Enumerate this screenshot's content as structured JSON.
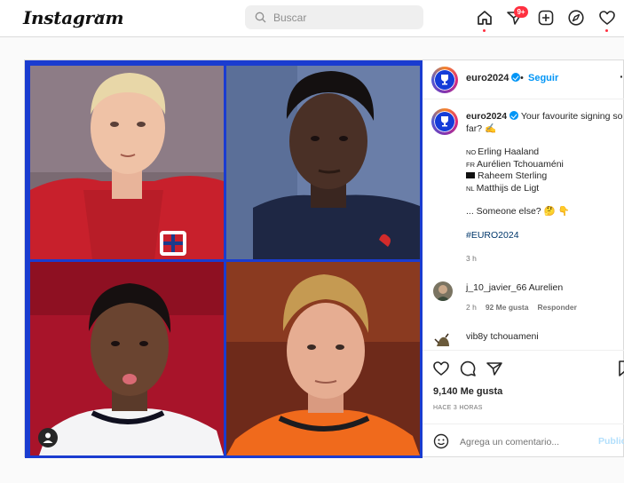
{
  "topbar": {
    "logo": "Instagram",
    "search_placeholder": "Buscar",
    "notification_badge": "9+",
    "icons": [
      "home-icon",
      "direct-icon",
      "new-post-icon",
      "explore-icon",
      "heart-icon"
    ]
  },
  "post": {
    "author": "euro2024",
    "follow_label": "Seguir",
    "separator": "•",
    "more_label": "···",
    "caption": {
      "username": "euro2024",
      "text": "Your favourite signing so far? ✍️",
      "players": [
        {
          "code": "NO",
          "name": "Erling Haaland"
        },
        {
          "code": "FR",
          "name": "Aurélien Tchouaméni"
        },
        {
          "code": "",
          "name": "Raheem Sterling"
        },
        {
          "code": "NL",
          "name": "Matthijs de Ligt"
        }
      ],
      "follow_up": "... Someone else? 🤔 👇",
      "hashtag": "#EURO2024",
      "time": "3 h"
    },
    "comments": [
      {
        "user": "j_10_javier_66",
        "text": "Aurelien",
        "time": "2 h",
        "likes": "92 Me gusta",
        "reply": "Responder"
      },
      {
        "user": "vib8y",
        "text": "tchouameni"
      }
    ],
    "likes": "9,140 Me gusta",
    "posted": "HACE 3 HORAS",
    "comment_placeholder": "Agrega un comentario...",
    "publish_label": "Publicar"
  },
  "colors": {
    "accent": "#0095f6",
    "euro_blue": "#1a3cd0",
    "notify_red": "#ff3040"
  }
}
